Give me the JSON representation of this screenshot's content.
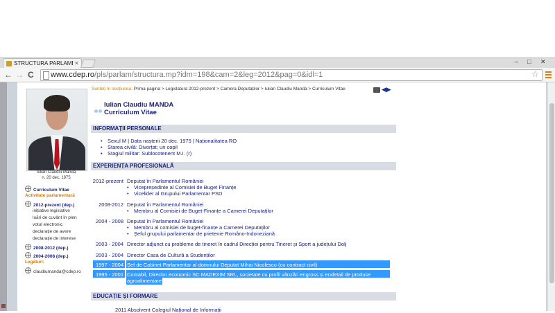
{
  "browser": {
    "tab_title": "STRUCTURA PARLAMENTU",
    "tab_close": "×",
    "url_host": "www.cdep.ro",
    "url_path": "/pls/parlam/structura.mp?idm=198&cam=2&leg=2012&pag=0&idl=1",
    "back": "←",
    "forward": "→",
    "reload": "C",
    "star": "☆",
    "minimize": "–",
    "maximize": "□",
    "close": "✕"
  },
  "sidebar": {
    "caption_name": "Iulian Claudiu Manda",
    "caption_born": "n. 20 dec. 1975",
    "cv_label": "Curriculum Vitae",
    "activity_label": "Activitate parlamentară",
    "term_2012": "2012-prezent (dep.)",
    "items_2012": [
      "inițiative legislative",
      "luări de cuvânt în plen",
      "votul electronic",
      "declarație de avere",
      "declarație de interese"
    ],
    "term_2008": "2008-2012 (dep.)",
    "term_2004": "2004-2008 (dep.)",
    "links_label": "Legături:",
    "email": "claudiumanda@cdep.ro"
  },
  "breadcrumb": {
    "label": "Sunteți în secțiunea:",
    "path": "Prima pagina > Legislatura 2012-prezent > Camera Deputaților > Iulian Claudiu Manda > Curriculum Vitae"
  },
  "header": {
    "name": "Iulian Claudiu MANDA",
    "subtitle": "Curriculum Vitae"
  },
  "personal": {
    "section_title": "INFORMAȚII PERSONALE",
    "lines": [
      "Sexul M | Data nașterii 20 dec. 1975 | Naționalitatea RO",
      "Starea civilă: Divorțat; un copil",
      "Stagiul militar: Sublocotenent M.I. (r)"
    ]
  },
  "experience": {
    "section_title": "EXPERIENȚA PROFESIONALĂ",
    "entries": [
      {
        "year": "2012-prezent",
        "title": "Deputat în Parlamentul României",
        "bullets": [
          "Vicepreședinte al Comisiei de Buget Finanțe",
          "Vicelider al Grupului Parlamentar PSD"
        ]
      },
      {
        "year": "2008-2012",
        "title": "Deputat în Parlamentul României",
        "bullets": [
          "Membru al Comisiei de Buget-Finanțe a Camerei Deputaților"
        ]
      },
      {
        "year": "2004 - 2008",
        "title": "Deputat în Parlamentul României",
        "bullets": [
          "Membru al comisiei de buget-finanțe a Camerei Deputaților",
          "Șeful grupului parlamentar de prietenie Româno-Indoneziană"
        ]
      },
      {
        "year": "2003 - 2004",
        "title": "Director adjunct cu probleme de tineret în cadrul Direcției pentru Tineret și Sport a județului Dolj"
      },
      {
        "year": "2003 - 2004",
        "title": "Director Casa de Cultură a Studenților"
      },
      {
        "year": "1997 - 2004",
        "title": "Șef de Cabinet Parlamentar al domnului Deputat Mihai Nicolescu (cu contract civil)"
      },
      {
        "year": "1995 - 2001",
        "title": "Contabil, Director economic SC MADEXIM SRL, societate cu profil vânzări engross și endetail de produse",
        "title2": "agroalimentare"
      }
    ]
  },
  "education": {
    "section_title": "EDUCAȚIE ȘI FORMARE",
    "partial_line": "2011    Absolvent Colegiul Național de Informații"
  }
}
